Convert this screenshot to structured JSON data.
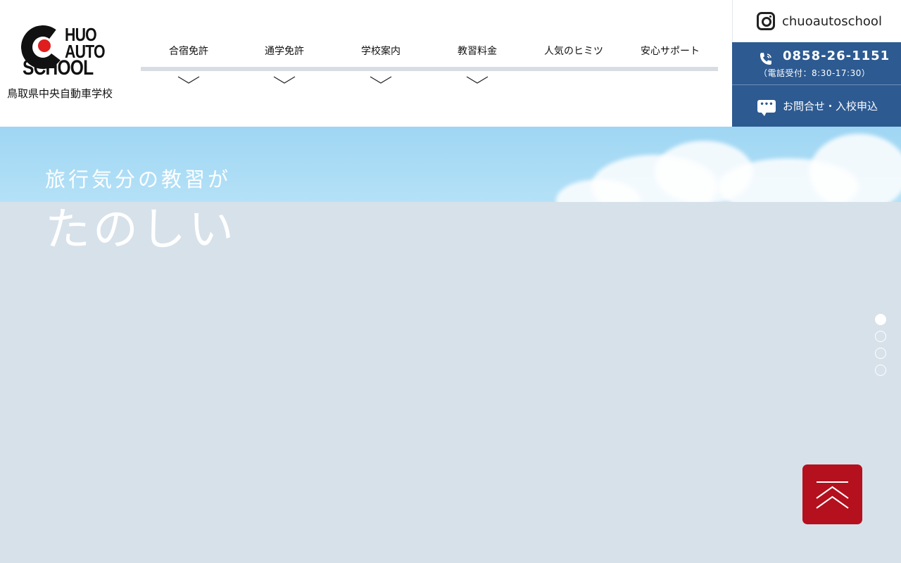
{
  "logo": {
    "line1": "HUO",
    "line2": "AUTO",
    "line3": "SCHOOL",
    "school_name": "鳥取県中央自動車学校"
  },
  "nav": {
    "items": [
      {
        "label": "合宿免許",
        "icon": "chevron-down-icon"
      },
      {
        "label": "通学免許",
        "icon": "chevron-down-icon"
      },
      {
        "label": "学校案内",
        "icon": "chevron-down-icon"
      },
      {
        "label": "教習料金",
        "icon": "chevron-down-icon"
      },
      {
        "label": "人気のヒミツ"
      },
      {
        "label": "安心サポート"
      }
    ]
  },
  "instagram": {
    "label": "chuoautoschool",
    "icon": "instagram-icon"
  },
  "phone": {
    "number": "0858-26-1151",
    "hours": "（電話受付：8:30-17:30）",
    "icon": "phone-icon"
  },
  "contact": {
    "label": "お問合せ・入校申込",
    "icon": "chat-icon",
    "icon_text": "•••"
  },
  "hero": {
    "subtitle": "旅行気分の教習が",
    "title": "たのしい"
  },
  "slider": {
    "count": 4,
    "active": 1
  },
  "colors": {
    "brand_blue": "#2d5a91",
    "accent_red": "#b5101d",
    "logo_red": "#e01e1e",
    "sky": "#9fd6f3",
    "page_bg": "#d7e1ea"
  }
}
